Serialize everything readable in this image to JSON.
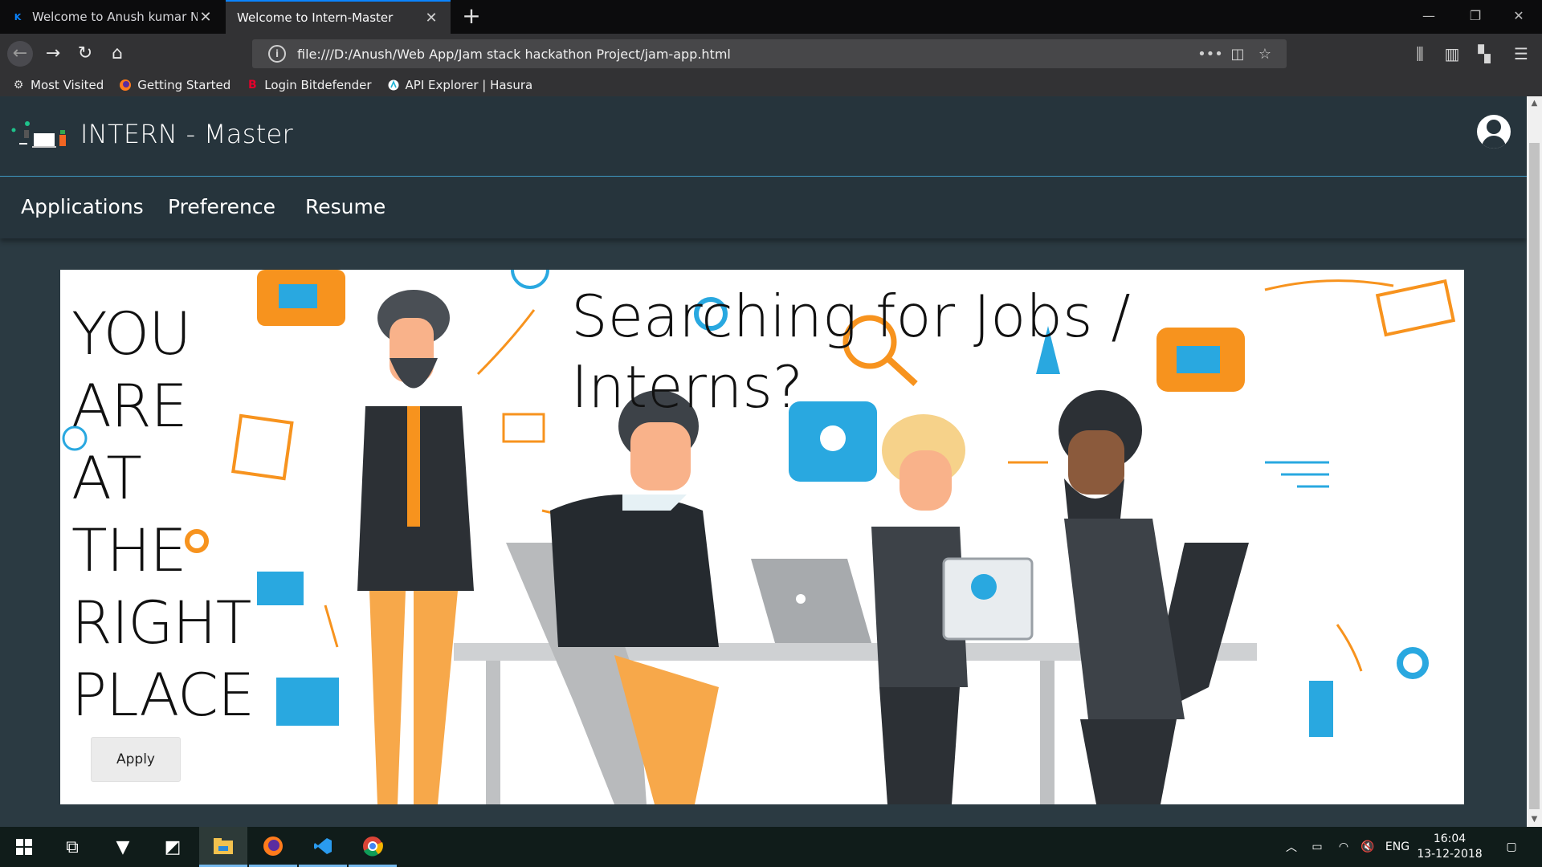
{
  "browser": {
    "tabs": [
      {
        "title": "Welcome to Anush kumar N's p",
        "favicon": "K",
        "active": false
      },
      {
        "title": "Welcome to Intern-Master",
        "favicon": "",
        "active": true
      }
    ],
    "url": "file:///D:/Anush/Web App/Jam stack hackathon Project/jam-app.html",
    "bookmarks": [
      {
        "label": "Most Visited",
        "icon": "gear-icon"
      },
      {
        "label": "Getting Started",
        "icon": "firefox-icon"
      },
      {
        "label": "Login Bitdefender",
        "icon": "bitdefender-icon"
      },
      {
        "label": "API Explorer | Hasura",
        "icon": "hasura-icon"
      }
    ]
  },
  "site": {
    "title": "INTERN - Master",
    "nav": [
      "Applications",
      "Preference",
      "Resume"
    ]
  },
  "hero": {
    "left_lines": [
      "YOU",
      "ARE",
      "AT",
      "THE",
      "RIGHT",
      "PLACE"
    ],
    "heading_line1": "Searching for Jobs /",
    "heading_line2": "Interns?",
    "apply_label": "Apply"
  },
  "taskbar": {
    "time": "16:04",
    "date": "13-12-2018",
    "language": "ENG"
  },
  "colors": {
    "header_bg": "#26343c",
    "page_bg": "#2b3a42",
    "accent_orange": "#f7931e",
    "accent_blue": "#29a8e0",
    "header_divider": "#3e9cc8"
  }
}
